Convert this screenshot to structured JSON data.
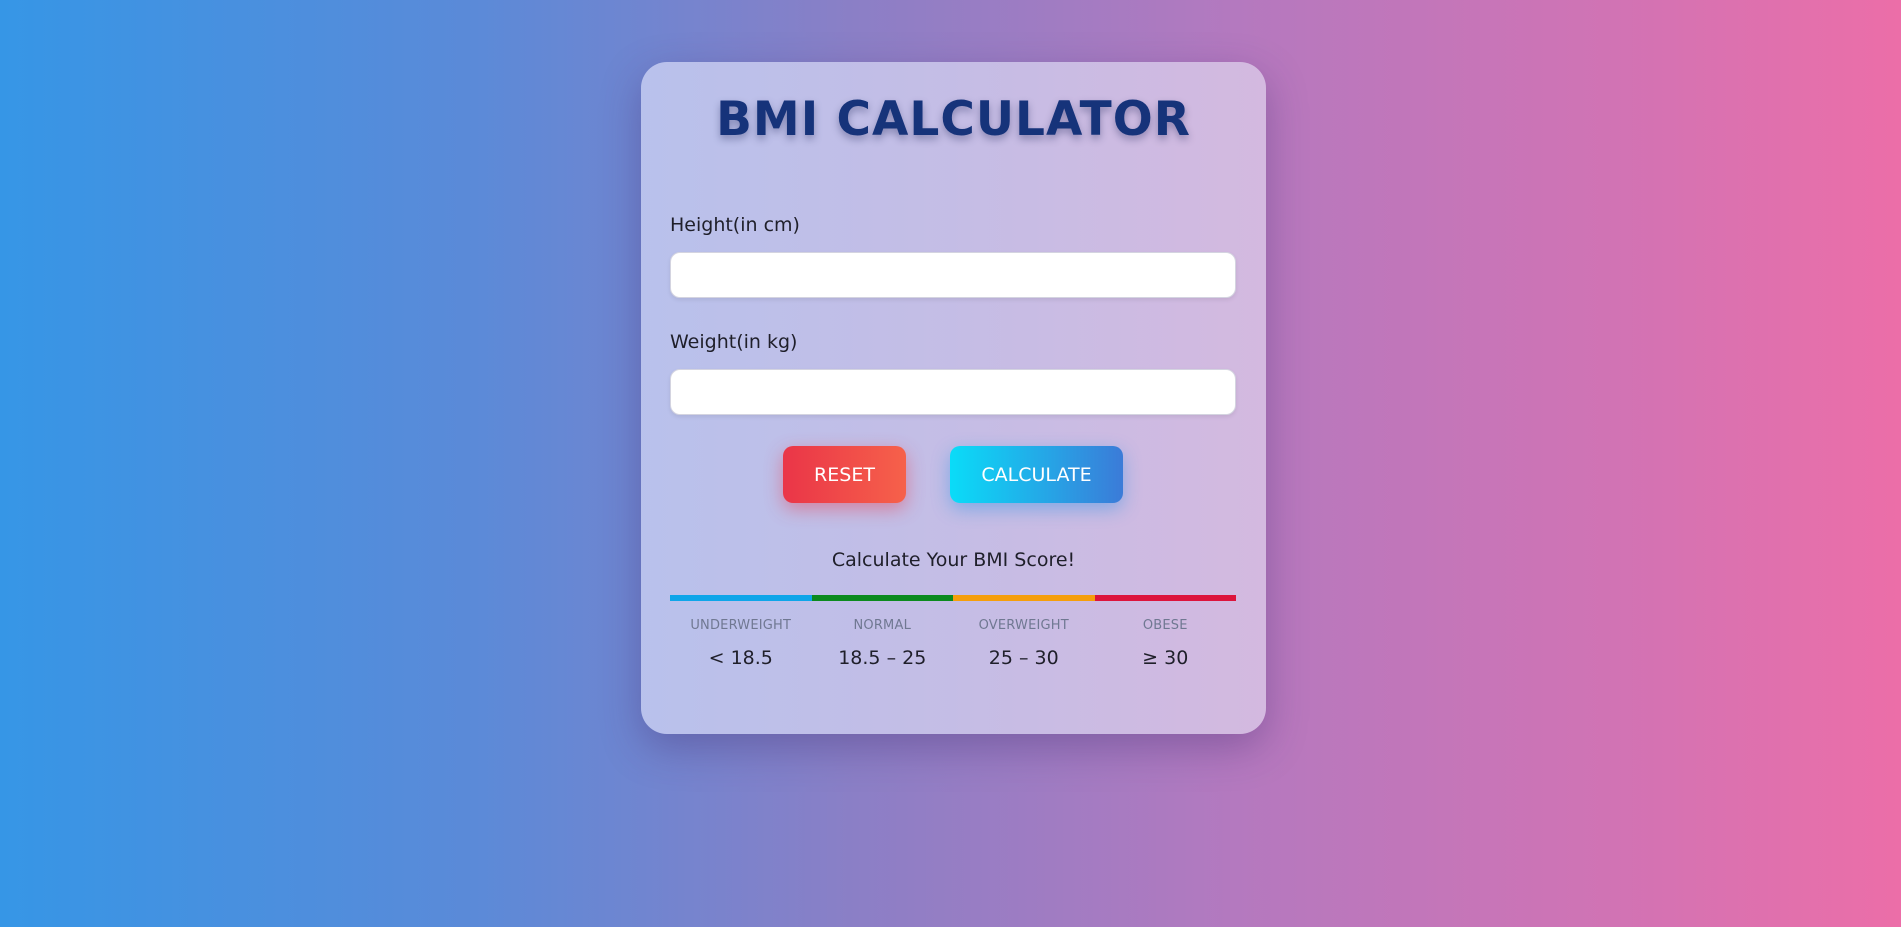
{
  "app": {
    "title": "BMI CALCULATOR"
  },
  "form": {
    "height_label": "Height(in cm)",
    "height_value": "",
    "weight_label": "Weight(in kg)",
    "weight_value": ""
  },
  "buttons": {
    "reset_label": "RESET",
    "calculate_label": "CALCULATE"
  },
  "result": {
    "message": "Calculate Your BMI Score!"
  },
  "scale": [
    {
      "name": "UNDERWEIGHT",
      "range": "< 18.5",
      "color": "#0ea5e9"
    },
    {
      "name": "NORMAL",
      "range": "18.5 – 25",
      "color": "#0b8a1e"
    },
    {
      "name": "OVERWEIGHT",
      "range": "25 – 30",
      "color": "#f59e0b"
    },
    {
      "name": "OBESE",
      "range": "≥ 30",
      "color": "#dc143c"
    }
  ],
  "colors": {
    "title": "#16337a",
    "reset_gradient": [
      "#ea3548",
      "#f6614a"
    ],
    "calculate_gradient": [
      "#0adcf8",
      "#3b7bd8"
    ]
  }
}
